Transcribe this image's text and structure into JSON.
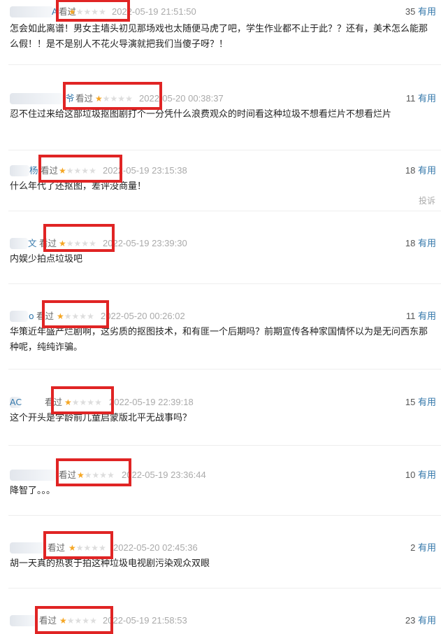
{
  "colors": {
    "highlight": "#e02424",
    "link": "#3377aa",
    "star": "#f5a623"
  },
  "icons": {
    "star_filled": "star-icon",
    "star_empty": "star-empty-icon"
  },
  "comments": [
    {
      "user": "A",
      "status": "看过",
      "rating": 1,
      "time": "2022-05-19 21:51:50",
      "votes": "35",
      "useful": "有用",
      "text": "怎会如此离谱！男女主墙头初见那场戏也太随便马虎了吧，学生作业都不止于此？？还有，美术怎么能那么假！！是不是别人不花火导演就把我们当傻子呀？！"
    },
    {
      "user": "爷",
      "status": "看过",
      "rating": 1,
      "time": "2022-05-20 00:38:37",
      "votes": "11",
      "useful": "有用",
      "text": "忍不住过来给这部垃圾抠图剧打个一分凭什么浪费观众的时间看这种垃圾不想看烂片不想看烂片"
    },
    {
      "user": "杨",
      "status": "看过",
      "rating": 1,
      "time": "2022-05-19 23:15:38",
      "votes": "18",
      "useful": "有用",
      "text": "什么年代了还抠图，差评没商量！",
      "report": "投诉"
    },
    {
      "user": "文",
      "status": "看过",
      "rating": 1,
      "time": "2022-05-19 23:39:30",
      "votes": "18",
      "useful": "有用",
      "text": "内娱少拍点垃圾吧"
    },
    {
      "user": "o",
      "status": "看过",
      "rating": 1,
      "time": "2022-05-20 00:26:02",
      "votes": "11",
      "useful": "有用",
      "text": "华策近年盛产烂剧啊，这劣质的抠图技术，和有匪一个后期吗？前期宣传各种家国情怀以为是无问西东那种呢，纯纯诈骗。"
    },
    {
      "user": "AC",
      "status": "看过",
      "rating": 1,
      "time": "2022-05-19 22:39:18",
      "votes": "15",
      "useful": "有用",
      "text": "这个开头是学龄前儿童启蒙版北平无战事吗？"
    },
    {
      "user": "",
      "status": "看过",
      "rating": 1,
      "time": "2022-05-19 23:36:44",
      "votes": "10",
      "useful": "有用",
      "text": "降智了。。。"
    },
    {
      "user": "",
      "status": "看过",
      "rating": 1,
      "time": "2022-05-20 02:45:36",
      "votes": "2",
      "useful": "有用",
      "text": "胡一天真的热衷于拍这种垃圾电视剧污染观众双眼"
    },
    {
      "user": "",
      "status": "看过",
      "rating": 1,
      "time": "2022-05-19 21:58:53",
      "votes": "23",
      "useful": "有用",
      "text": ""
    }
  ]
}
